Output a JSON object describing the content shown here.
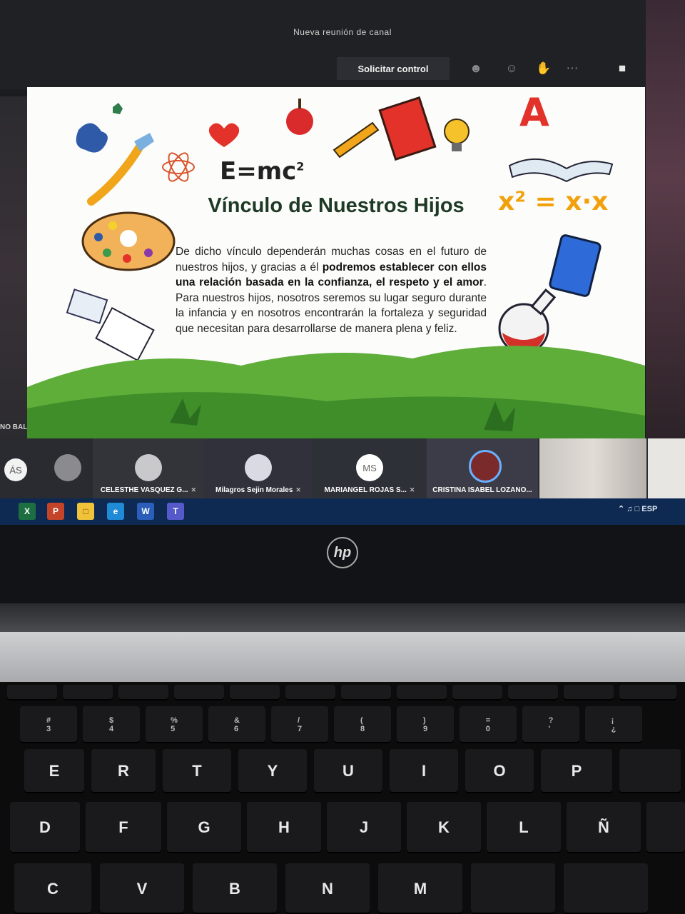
{
  "meeting": {
    "title": "Nueva reunión de canal",
    "request_control_label": "Solicitar control"
  },
  "slide": {
    "formula": "E=mc",
    "formula_exp": "2",
    "formula_right": "x² = x·x",
    "letter": "A",
    "title": "Vínculo de Nuestros Hijos",
    "body_1": "De dicho vínculo dependerán muchas cosas en el futuro de nuestros hijos, y gracias a él ",
    "body_bold_1": "podremos establecer con ellos una relación basada en la confianza, el respeto y el amor",
    "body_2": ". Para nuestros hijos, nosotros seremos su lugar seguro durante la infancia y en nosotros encontrarán la fortaleza y seguridad que necesitan para desarrollarse de manera plena y feliz."
  },
  "side_label": "NO BALOCO",
  "participants": [
    {
      "initials": "ÁS",
      "name": ""
    },
    {
      "initials": "",
      "name": ""
    },
    {
      "initials": "",
      "name": "CELESTHE VASQUEZ G..."
    },
    {
      "initials": "",
      "name": "Milagros Sejin Morales"
    },
    {
      "initials": "MS",
      "name": "MARIANGEL ROJAS S..."
    },
    {
      "initials": "",
      "name": "CRISTINA ISABEL LOZANO..."
    }
  ],
  "taskbar": {
    "apps": [
      "X",
      "P",
      "folder",
      "e",
      "W",
      "T"
    ],
    "tray_lang": "ESP"
  },
  "laptop": {
    "brand": "hp"
  },
  "keyboard": {
    "row_numbers": [
      "#\n3",
      "$\n4",
      "%\n5",
      "&\n6",
      "/\n7",
      "(\n8",
      ")\n9",
      "=\n0",
      "?\n'",
      "¡\n¿"
    ],
    "row_top": [
      "E",
      "R",
      "T",
      "Y",
      "U",
      "I",
      "O",
      "P"
    ],
    "row_home": [
      "D",
      "F",
      "G",
      "H",
      "J",
      "K",
      "L",
      "Ñ"
    ],
    "row_bottom": [
      "C",
      "V",
      "B",
      "N",
      "M"
    ]
  },
  "colors": {
    "accent_teams": "#0e2a52",
    "slide_title": "#1f3a24",
    "hill_green": "#5fae3a"
  }
}
